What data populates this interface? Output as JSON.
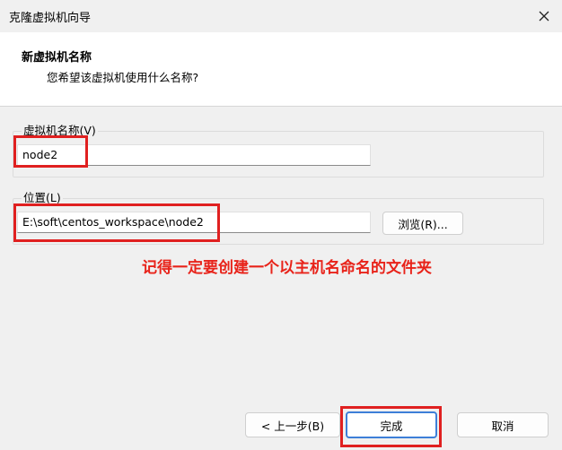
{
  "window": {
    "title": "克隆虚拟机向导",
    "close_icon": "close-icon"
  },
  "header": {
    "heading": "新虚拟机名称",
    "subheading": "您希望该虚拟机使用什么名称?"
  },
  "name_group": {
    "label": "虚拟机名称(V)",
    "value": "node2"
  },
  "location_group": {
    "label": "位置(L)",
    "value": "E:\\soft\\centos_workspace\\node2",
    "browse_label": "浏览(R)..."
  },
  "annotation": {
    "text": "记得一定要创建一个以主机名命名的文件夹",
    "color": "#e8231a"
  },
  "footer": {
    "back_label": "< 上一步(B)",
    "finish_label": "完成",
    "cancel_label": "取消"
  },
  "colors": {
    "highlight_box": "#e02020",
    "primary_border": "#3d7fd8"
  }
}
